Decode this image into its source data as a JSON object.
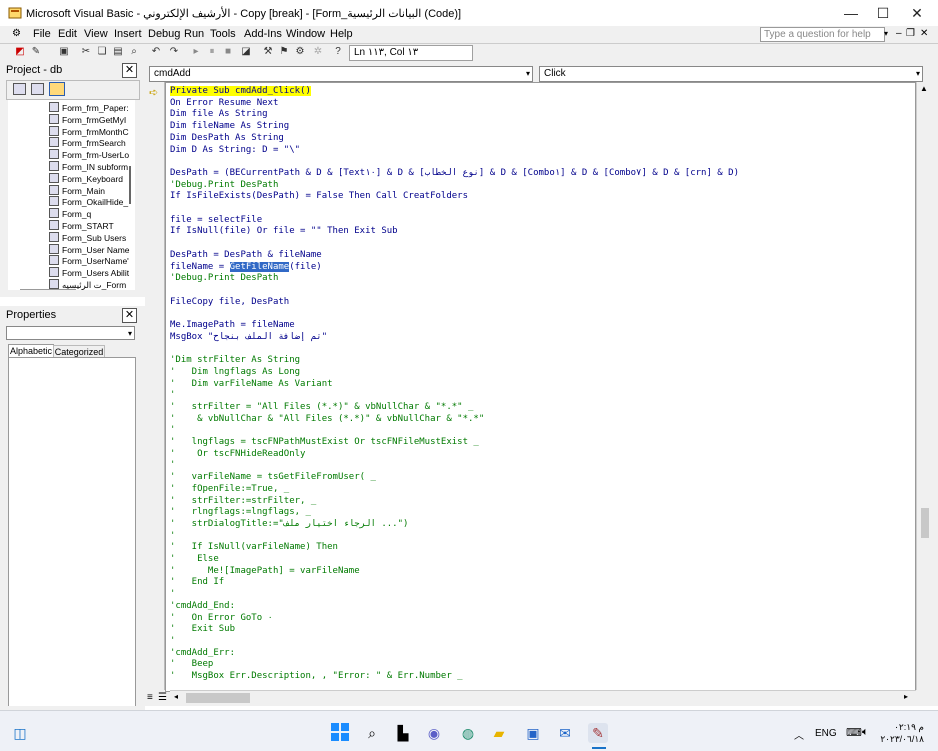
{
  "window": {
    "title": "Microsoft Visual Basic - الأرشيف الإلكتروني - Copy [break] - [Form_البيانات الرئيسية (Code)]",
    "controls": {
      "minimize": "—",
      "maximize": "☐",
      "close": "✕"
    }
  },
  "menu": {
    "items": [
      "File",
      "Edit",
      "View",
      "Insert",
      "Debug",
      "Run",
      "Tools",
      "Add-Ins",
      "Window",
      "Help"
    ],
    "help_placeholder": "Type a question for help"
  },
  "toolbar": {
    "position": "Ln ١١٣, Col ١٣"
  },
  "project_panel": {
    "title": "Project - db",
    "items": [
      "Form_frm_Paper:",
      "Form_frmGetMyI",
      "Form_frmMonthC",
      "Form_frmSearch",
      "Form_frm-UserLo",
      "Form_IN subform",
      "Form_Keyboard",
      "Form_Main",
      "Form_OkailHide_",
      "Form_q",
      "Form_START",
      "Form_Sub Users",
      "Form_User Name",
      "Form_UserName'",
      "Form_Users Abilit",
      "ت الرئيسيه_Form"
    ]
  },
  "properties_panel": {
    "title": "Properties",
    "tabs": [
      "Alphabetic",
      "Categorized"
    ]
  },
  "code_window": {
    "object_combo": "cmdAdd",
    "procedure_combo": "Click",
    "lines": [
      {
        "t": "Private Sub cmdAdd_Click()",
        "c": "hl"
      },
      {
        "t": "On Error Resume Next",
        "c": "kw"
      },
      {
        "t": "Dim file As String",
        "c": "kw"
      },
      {
        "t": "Dim fileName As String",
        "c": "kw"
      },
      {
        "t": "Dim DesPath As String",
        "c": "kw"
      },
      {
        "t": "Dim D As String: D = \"\\\"",
        "c": "kw"
      },
      {
        "t": "",
        "c": ""
      },
      {
        "t": "DesPath = (BECurrentPath & D & [Text١٠] & D & [نوع الخطاب] & D & [Combo١] & D & [Combo٧] & D & [crn] & D)",
        "c": "kw"
      },
      {
        "t": "'Debug.Print DesPath",
        "c": "cm"
      },
      {
        "t": "If IsFileExists(DesPath) = False Then Call CreatFolders",
        "c": "kw"
      },
      {
        "t": "",
        "c": ""
      },
      {
        "t": "file = selectFile",
        "c": "kw"
      },
      {
        "t": "If IsNull(file) Or file = \"\" Then Exit Sub",
        "c": "kw"
      },
      {
        "t": "",
        "c": ""
      },
      {
        "t": "DesPath = DesPath & fileName",
        "c": "kw"
      },
      {
        "t": "fileName = |GetFileName|(file)",
        "c": "sel"
      },
      {
        "t": "'Debug.Print DesPath",
        "c": "cm"
      },
      {
        "t": "",
        "c": ""
      },
      {
        "t": "FileCopy file, DesPath",
        "c": "kw"
      },
      {
        "t": "",
        "c": ""
      },
      {
        "t": "Me.ImagePath = fileName",
        "c": "kw"
      },
      {
        "t": "MsgBox \"تم إضافة الملف بنجاح\"",
        "c": "kw"
      },
      {
        "t": "",
        "c": ""
      },
      {
        "t": "'Dim strFilter As String",
        "c": "cm"
      },
      {
        "t": "'   Dim lngflags As Long",
        "c": "cm"
      },
      {
        "t": "'   Dim varFileName As Variant",
        "c": "cm"
      },
      {
        "t": "'",
        "c": "cm"
      },
      {
        "t": "'   strFilter = \"All Files (*.*)\" & vbNullChar & \"*.*\" _",
        "c": "cm"
      },
      {
        "t": "'    & vbNullChar & \"All Files (*.*)\" & vbNullChar & \"*.*\"",
        "c": "cm"
      },
      {
        "t": "'",
        "c": "cm"
      },
      {
        "t": "'   lngflags = tscFNPathMustExist Or tscFNFileMustExist _",
        "c": "cm"
      },
      {
        "t": "'    Or tscFNHideReadOnly",
        "c": "cm"
      },
      {
        "t": "'",
        "c": "cm"
      },
      {
        "t": "'   varFileName = tsGetFileFromUser( _",
        "c": "cm"
      },
      {
        "t": "'   fOpenFile:=True, _",
        "c": "cm"
      },
      {
        "t": "'   strFilter:=strFilter, _",
        "c": "cm"
      },
      {
        "t": "'   rlngflags:=lngflags, _",
        "c": "cm"
      },
      {
        "t": "'   strDialogTitle:=\"الرجاء اختيار ملف ...\")",
        "c": "cm"
      },
      {
        "t": "'",
        "c": "cm"
      },
      {
        "t": "'   If IsNull(varFileName) Then",
        "c": "cm"
      },
      {
        "t": "'    Else",
        "c": "cm"
      },
      {
        "t": "'      Me![ImagePath] = varFileName",
        "c": "cm"
      },
      {
        "t": "'   End If",
        "c": "cm"
      },
      {
        "t": "'",
        "c": "cm"
      },
      {
        "t": "'cmdAdd_End:",
        "c": "cm"
      },
      {
        "t": "'   On Error GoTo ٠",
        "c": "cm"
      },
      {
        "t": "'   Exit Sub",
        "c": "cm"
      },
      {
        "t": "'",
        "c": "cm"
      },
      {
        "t": "'cmdAdd_Err:",
        "c": "cm"
      },
      {
        "t": "'   Beep",
        "c": "cm"
      },
      {
        "t": "'   MsgBox Err.Description, , \"Error: \" & Err.Number _",
        "c": "cm"
      }
    ]
  },
  "taskbar": {
    "lang": "ENG",
    "time": "م ٠٢:١٩",
    "date": "٢٠٢٣/٠٦/١٨"
  },
  "colors": {
    "accent": "#3169c6",
    "breakpoint_highlight": "#ffff00",
    "comment": "#007a00",
    "keyword": "#00008b"
  }
}
